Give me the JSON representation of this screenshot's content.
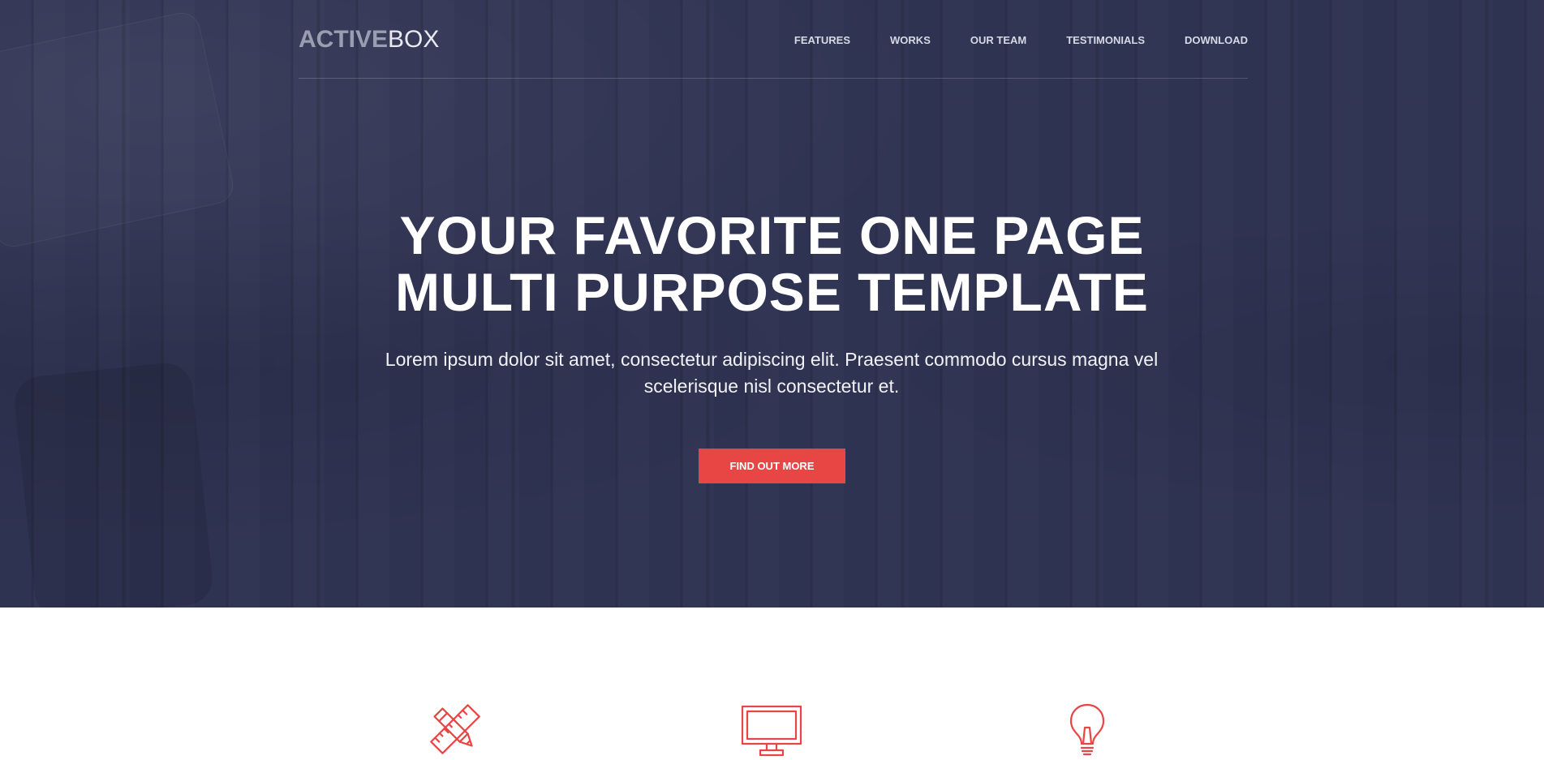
{
  "brand": {
    "logo_strong": "ACTIVE",
    "logo_light": "BOX"
  },
  "nav": {
    "items": [
      {
        "label": "FEATURES"
      },
      {
        "label": "WORKS"
      },
      {
        "label": "OUR TEAM"
      },
      {
        "label": "TESTIMONIALS"
      },
      {
        "label": "DOWNLOAD"
      }
    ]
  },
  "hero": {
    "title_line1": "YOUR FAVORITE ONE PAGE",
    "title_line2": "MULTI PURPOSE TEMPLATE",
    "subtitle_line1": "Lorem ipsum dolor sit amet, consectetur adipiscing elit. Praesent commodo cursus magna vel",
    "subtitle_line2": "scelerisque nisl consectetur et.",
    "cta_label": "FIND OUT MORE"
  },
  "features": {
    "icons": [
      {
        "name": "pencil-ruler-icon"
      },
      {
        "name": "monitor-icon"
      },
      {
        "name": "lightbulb-icon"
      }
    ]
  },
  "colors": {
    "hero_bg": "#2f3352",
    "accent": "#e84545",
    "nav_text": "#d7d9e4"
  }
}
